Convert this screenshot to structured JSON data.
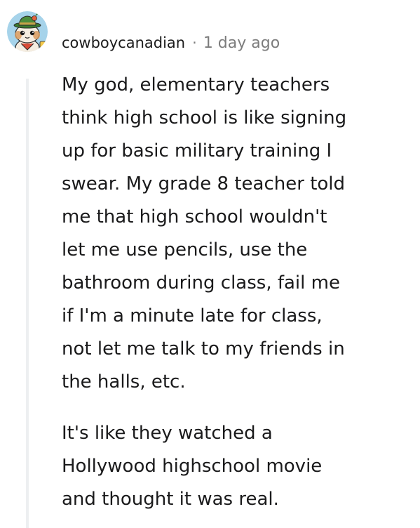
{
  "comment": {
    "username": "cowboycanadian",
    "separator": "·",
    "timestamp": "1 day ago",
    "avatar_icon": "snoo-avatar-icon",
    "paragraphs": [
      {
        "lines": [
          "My god, elementary teachers",
          "think high school is like signing",
          "up for basic military training I",
          "swear. My grade 8 teacher told",
          "me that high school wouldn't",
          "let me use pencils, use the",
          "bathroom during class, fail me",
          "if I'm a minute late for class,",
          "not let me talk to my friends in",
          "the halls, etc."
        ]
      },
      {
        "lines": [
          "It's like they watched a",
          "Hollywood highschool movie",
          "and thought it was real."
        ]
      }
    ]
  },
  "colors": {
    "text": "#1a1a1b",
    "meta": "#7c7c7c",
    "thread_line": "#edeff1",
    "avatar_bg": "#a6d3ea",
    "avatar_hat": "#4c8c3c"
  }
}
